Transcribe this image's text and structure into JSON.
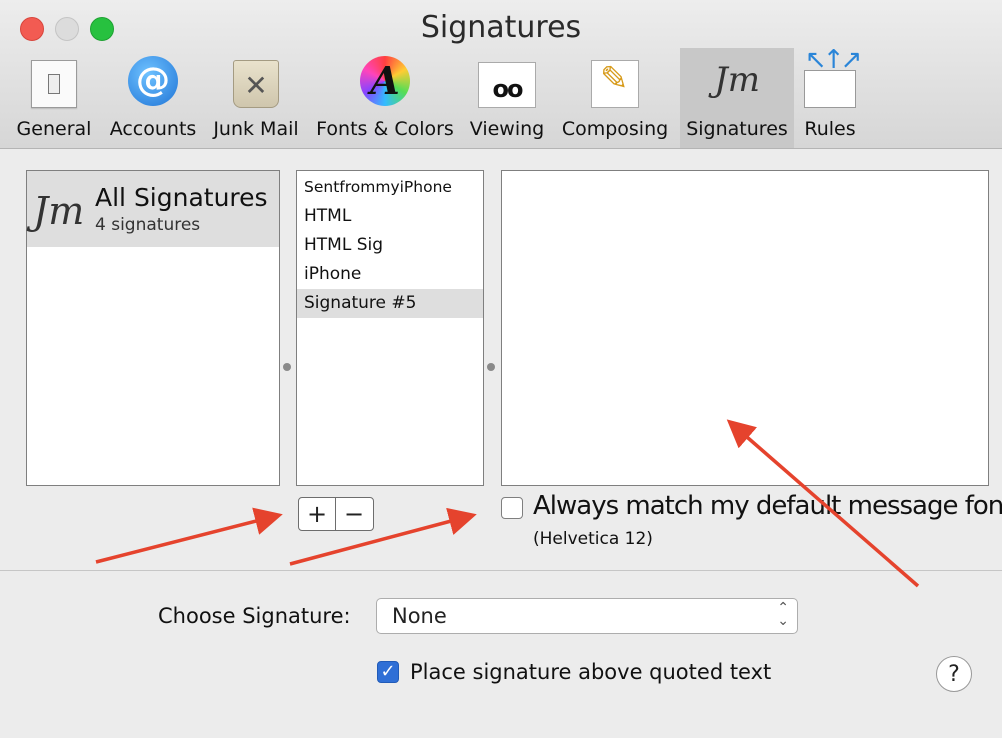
{
  "window": {
    "title": "Signatures"
  },
  "toolbar": {
    "items": [
      {
        "label": "General",
        "icon": "general-switch-icon"
      },
      {
        "label": "Accounts",
        "icon": "at-sign-icon"
      },
      {
        "label": "Junk Mail",
        "icon": "trash-bin-icon"
      },
      {
        "label": "Fonts & Colors",
        "icon": "font-color-wheel-icon"
      },
      {
        "label": "Viewing",
        "icon": "glasses-envelope-icon"
      },
      {
        "label": "Composing",
        "icon": "pencil-paper-icon"
      },
      {
        "label": "Signatures",
        "icon": "signature-scribble-icon",
        "selected": true
      },
      {
        "label": "Rules",
        "icon": "envelope-arrows-icon"
      }
    ],
    "accounts_glyph": "@",
    "junk_glyph": "✕",
    "fonts_glyph": "A",
    "viewing_glyph": "oo",
    "composing_glyph": "✎",
    "signatures_glyph": "Jm",
    "rules_glyph": "↖↑↗"
  },
  "accounts_pane": {
    "title": "All Signatures",
    "count": "4 signatures",
    "glyph": "Jm"
  },
  "signature_list": {
    "items": [
      {
        "label": "SentfrommyiPhone"
      },
      {
        "label": "HTML"
      },
      {
        "label": "HTML Sig"
      },
      {
        "label": "iPhone"
      },
      {
        "label": "Signature #5",
        "selected": true
      }
    ]
  },
  "controls": {
    "add_label": "+",
    "remove_label": "−",
    "always_match_label": "Always match my default message font",
    "always_match_checked": false,
    "font_hint": "(Helvetica 12)",
    "choose_signature_label": "Choose Signature:",
    "choose_signature_value": "None",
    "select_arrows_up": "⌃",
    "select_arrows_down": "⌄",
    "place_above_label": "Place signature above quoted text",
    "place_above_checked": true,
    "checkmark": "✓",
    "help_label": "?"
  },
  "colors": {
    "annotation_arrow": "#e5432d",
    "accent": "#2f6fd6"
  }
}
